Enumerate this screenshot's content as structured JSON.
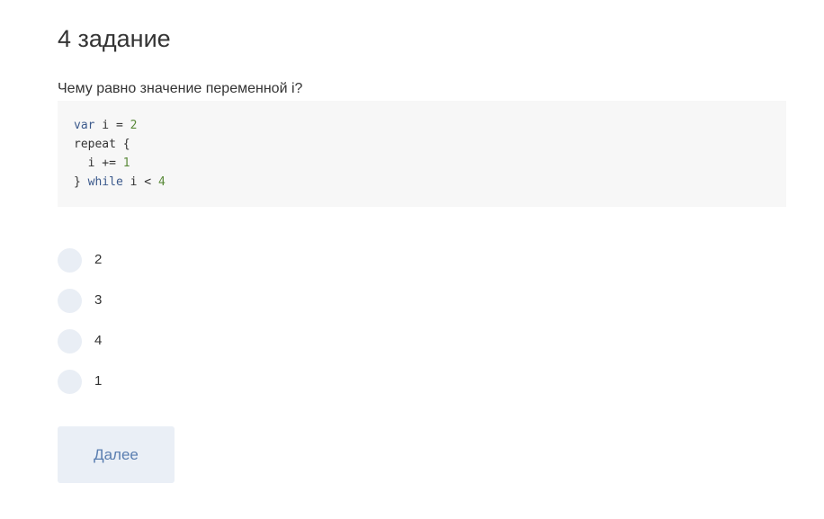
{
  "page": {
    "title": "4 задание",
    "question": "Чему равно значение переменной i?"
  },
  "code": {
    "lines": [
      [
        {
          "type": "kw",
          "text": "var"
        },
        {
          "type": "plain",
          "text": " i = "
        },
        {
          "type": "num",
          "text": "2"
        }
      ],
      [
        {
          "type": "plain",
          "text": "repeat {"
        }
      ],
      [
        {
          "type": "plain",
          "text": "  i += "
        },
        {
          "type": "num",
          "text": "1"
        }
      ],
      [
        {
          "type": "plain",
          "text": "} "
        },
        {
          "type": "kw",
          "text": "while"
        },
        {
          "type": "plain",
          "text": " i < "
        },
        {
          "type": "num",
          "text": "4"
        }
      ]
    ]
  },
  "options": [
    {
      "label": "2"
    },
    {
      "label": "3"
    },
    {
      "label": "4"
    },
    {
      "label": "1"
    }
  ],
  "actions": {
    "next_label": "Далее"
  },
  "colors": {
    "code_background": "#f7f7f7",
    "keyword": "#3c5a8c",
    "number": "#5a8a3a",
    "radio_fill": "#e9eef5",
    "button_background": "#eaeff6",
    "button_text": "#5a7eb0"
  }
}
